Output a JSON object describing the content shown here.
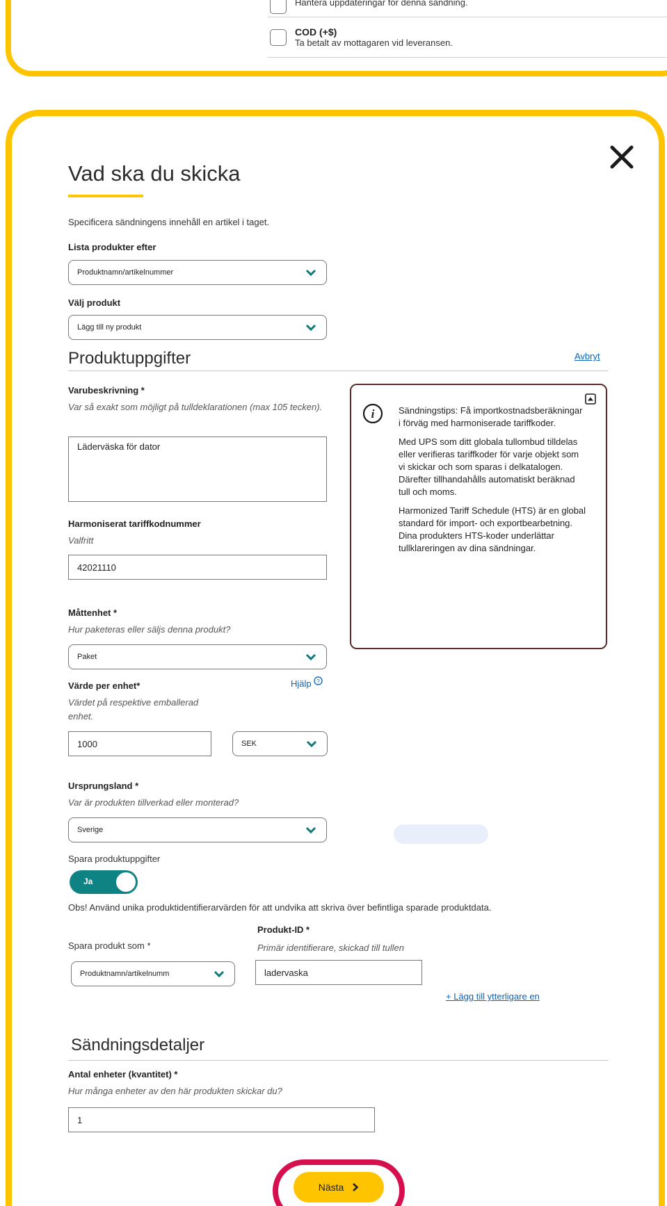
{
  "top_options": [
    {
      "title": "",
      "desc": "Hantera uppdateringar för denna sändning."
    },
    {
      "title": "COD (+$)",
      "desc": "Ta betalt av mottagaren vid leveransen."
    }
  ],
  "modal": {
    "title": "Vad ska du skicka",
    "intro": "Specificera sändningens innehåll en artikel i taget.",
    "list_by": {
      "label": "Lista produkter efter",
      "value": "Produktnamn/artikelnummer"
    },
    "choose_product": {
      "label": "Välj produkt",
      "value": "Lägg till ny produkt"
    }
  },
  "product_details": {
    "heading": "Produktuppgifter",
    "cancel_link": "Avbryt",
    "description": {
      "label": "Varubeskrivning *",
      "hint": "Var så exakt som möjligt på tulldeklarationen (max 105 tecken).",
      "value": "Läderväska för dator"
    },
    "tariff": {
      "label": "Harmoniserat tariffkodnummer",
      "hint": "Valfritt",
      "value": "42021110"
    },
    "unit": {
      "label": "Måttenhet *",
      "hint": "Hur paketeras eller säljs denna produkt?",
      "value": "Paket"
    },
    "value_per_unit": {
      "label": "Värde per enhet*",
      "help": "Hjälp",
      "hint": "Värdet på respektive emballerad enhet.",
      "value": "1000",
      "currency": "SEK"
    },
    "origin": {
      "label": "Ursprungsland *",
      "hint": "Var är produkten tillverkad eller monterad?",
      "value": "Sverige"
    },
    "save": {
      "label": "Spara produktuppgifter",
      "toggle_label": "Ja"
    },
    "note": "Obs! Använd unika produktidentifierarvärden för att undvika att skriva över befintliga sparade produktdata.",
    "save_as": {
      "label": "Spara produkt som *",
      "value": "Produktnamn/artikelnumm"
    },
    "product_id": {
      "label": "Produkt-ID *",
      "hint": "Primär identifierare, skickad till tullen",
      "value": "ladervaska"
    },
    "add_more": "+ Lägg till ytterligare en"
  },
  "info_box": {
    "title": "Sändningstips: Få importkostnadsberäkningar i förväg med harmoniserade tariffkoder.",
    "p1": "Med UPS som ditt globala tullombud tilldelas eller verifieras tariffkoder för varje objekt som vi skickar och som sparas i delkatalogen. Därefter tillhandahålls automatiskt beräknad tull och moms.",
    "p2": "Harmonized Tariff Schedule (HTS) är en global standard för import- och exportbearbetning. Dina produkters HTS-koder underlättar tullklareringen av dina sändningar."
  },
  "shipment": {
    "heading": "Sändningsdetaljer",
    "quantity": {
      "label": "Antal enheter (kvantitet) *",
      "hint": "Hur många enheter av den här produkten skickar du?",
      "value": "1"
    }
  },
  "next_button": "Nästa",
  "colors": {
    "accent": "#ffc400",
    "teal": "#0f8383",
    "highlight": "#d6104f",
    "link": "#0b63b7"
  },
  "icons": [
    "close-icon",
    "chevron-down-icon",
    "info-icon",
    "collapse-icon",
    "help-icon",
    "chevron-right-icon"
  ]
}
